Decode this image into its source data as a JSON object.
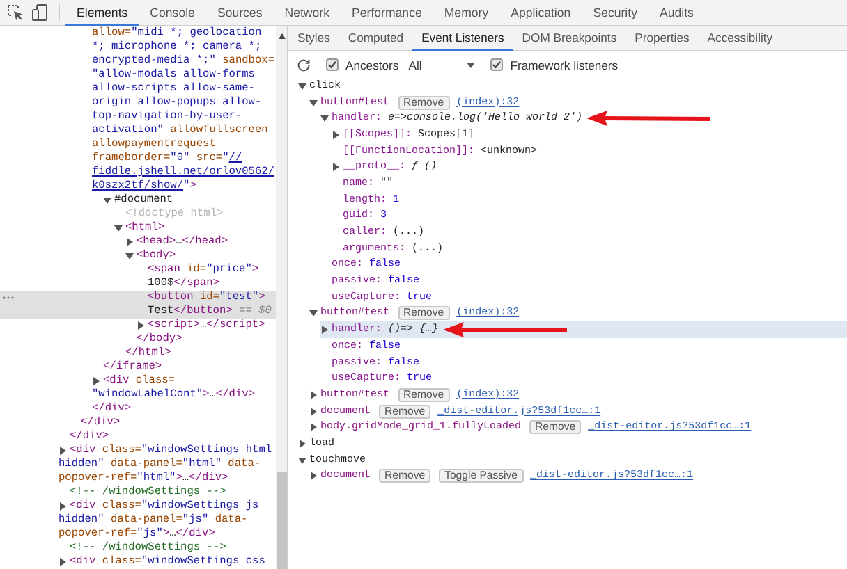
{
  "tabs": [
    {
      "label": "Elements",
      "selected": true
    },
    {
      "label": "Console",
      "selected": false
    },
    {
      "label": "Sources",
      "selected": false
    },
    {
      "label": "Network",
      "selected": false
    },
    {
      "label": "Performance",
      "selected": false
    },
    {
      "label": "Memory",
      "selected": false
    },
    {
      "label": "Application",
      "selected": false
    },
    {
      "label": "Security",
      "selected": false
    },
    {
      "label": "Audits",
      "selected": false
    }
  ],
  "dom": [
    {
      "children": [
        {
          "children": [
            {
              "children": [
                {
                  "selected": false,
                  "clipped_top": true,
                  "lines": [
                    [
                      {
                        "kind": "attr",
                        "text": "allow="
                      },
                      {
                        "kind": "value",
                        "text": "\"midi *; geolocation"
                      }
                    ],
                    [
                      {
                        "kind": "value",
                        "text": "*; microphone *; camera *;"
                      }
                    ],
                    [
                      {
                        "kind": "value",
                        "text": "encrypted-media *;\""
                      },
                      {
                        "kind": "attr",
                        "text": " sandbox="
                      }
                    ],
                    [
                      {
                        "kind": "value",
                        "text": "\"allow-modals allow-forms"
                      }
                    ],
                    [
                      {
                        "kind": "value",
                        "text": "allow-scripts allow-same-"
                      }
                    ],
                    [
                      {
                        "kind": "value",
                        "text": "origin allow-popups allow-"
                      }
                    ],
                    [
                      {
                        "kind": "value",
                        "text": "top-navigation-by-user-"
                      }
                    ],
                    [
                      {
                        "kind": "value",
                        "text": "activation\""
                      },
                      {
                        "kind": "attr",
                        "text": " allowfullscreen"
                      }
                    ],
                    [
                      {
                        "kind": "attr",
                        "text": "allowpaymentrequest"
                      }
                    ],
                    [
                      {
                        "kind": "attr",
                        "text": "frameborder="
                      },
                      {
                        "kind": "value",
                        "text": "\"0\""
                      },
                      {
                        "kind": "attr",
                        "text": " src="
                      },
                      {
                        "kind": "value",
                        "text": "\""
                      },
                      {
                        "kind": "link",
                        "text": "//"
                      }
                    ],
                    [
                      {
                        "kind": "link",
                        "text": "fiddle.jshell.net/orlov0562/"
                      }
                    ],
                    [
                      {
                        "kind": "link",
                        "text": "k0szx2tf/show/"
                      },
                      {
                        "kind": "value",
                        "text": "\""
                      },
                      {
                        "kind": "tag",
                        "text": ">"
                      }
                    ]
                  ],
                  "children": [
                    {
                      "selected": false,
                      "expanded": true,
                      "lines": [
                        [
                          {
                            "kind": "text",
                            "text": "#document"
                          }
                        ]
                      ],
                      "children": [
                        {
                          "selected": false,
                          "lines": [
                            [
                              {
                                "kind": "doctype",
                                "text": "<!doctype html>"
                              }
                            ]
                          ]
                        },
                        {
                          "selected": false,
                          "expanded": true,
                          "lines": [
                            [
                              {
                                "kind": "tag",
                                "text": "<html>"
                              }
                            ]
                          ],
                          "children": [
                            {
                              "selected": false,
                              "expanded": false,
                              "lines": [
                                [
                                  {
                                    "kind": "tag",
                                    "text": "<head>"
                                  },
                                  {
                                    "kind": "text",
                                    "text": "…"
                                  },
                                  {
                                    "kind": "tag",
                                    "text": "</head>"
                                  }
                                ]
                              ]
                            },
                            {
                              "selected": false,
                              "expanded": true,
                              "lines": [
                                [
                                  {
                                    "kind": "tag",
                                    "text": "<body>"
                                  }
                                ]
                              ],
                              "children": [
                                {
                                  "selected": false,
                                  "lines": [
                                    [
                                      {
                                        "kind": "tag",
                                        "text": "<span "
                                      },
                                      {
                                        "kind": "attr",
                                        "text": "id="
                                      },
                                      {
                                        "kind": "value",
                                        "text": "\"price\""
                                      },
                                      {
                                        "kind": "tag",
                                        "text": ">"
                                      }
                                    ],
                                    [
                                      {
                                        "kind": "text",
                                        "text": "100$"
                                      },
                                      {
                                        "kind": "tag",
                                        "text": "</span>"
                                      }
                                    ]
                                  ]
                                },
                                {
                                  "selected": true,
                                  "lines": [
                                    [
                                      {
                                        "kind": "tag",
                                        "text": "<button "
                                      },
                                      {
                                        "kind": "attr",
                                        "text": "id="
                                      },
                                      {
                                        "kind": "value",
                                        "text": "\"test\""
                                      },
                                      {
                                        "kind": "tag",
                                        "text": ">"
                                      }
                                    ],
                                    [
                                      {
                                        "kind": "text",
                                        "text": "Test"
                                      },
                                      {
                                        "kind": "tag",
                                        "text": "</button>"
                                      },
                                      {
                                        "kind": "muted",
                                        "text": " == $0"
                                      }
                                    ]
                                  ]
                                },
                                {
                                  "selected": false,
                                  "expanded": false,
                                  "lines": [
                                    [
                                      {
                                        "kind": "tag",
                                        "text": "<script>"
                                      },
                                      {
                                        "kind": "text",
                                        "text": "…"
                                      },
                                      {
                                        "kind": "tag",
                                        "text": "</script>"
                                      }
                                    ]
                                  ]
                                }
                              ],
                              "close": [
                                {
                                  "kind": "tag",
                                  "text": "</body>"
                                }
                              ]
                            }
                          ],
                          "close": [
                            {
                              "kind": "tag",
                              "text": "</html>"
                            }
                          ]
                        }
                      ]
                    }
                  ],
                  "close": [
                    {
                      "kind": "tag",
                      "text": "</iframe>"
                    }
                  ]
                },
                {
                  "selected": false,
                  "expanded": false,
                  "lines": [
                    [
                      {
                        "kind": "tag",
                        "text": "<div "
                      },
                      {
                        "kind": "attr",
                        "text": "class="
                      }
                    ],
                    [
                      {
                        "kind": "value",
                        "text": "\"windowLabelCont\""
                      },
                      {
                        "kind": "tag",
                        "text": ">"
                      },
                      {
                        "kind": "text",
                        "text": "…"
                      },
                      {
                        "kind": "tag",
                        "text": "</div>"
                      }
                    ]
                  ]
                }
              ],
              "close": [
                {
                  "kind": "tag",
                  "text": "</div>"
                }
              ]
            }
          ],
          "close": [
            {
              "kind": "tag",
              "text": "</div>"
            }
          ]
        }
      ],
      "close": [
        {
          "kind": "tag",
          "text": "</div>"
        }
      ]
    },
    {
      "selected": false,
      "expanded": false,
      "lines": [
        [
          {
            "kind": "tag",
            "text": "<div "
          },
          {
            "kind": "attr",
            "text": "class="
          },
          {
            "kind": "value",
            "text": "\"windowSettings html"
          }
        ],
        [
          {
            "kind": "value",
            "text": "hidden\""
          },
          {
            "kind": "attr",
            "text": " data-panel="
          },
          {
            "kind": "value",
            "text": "\"html\""
          },
          {
            "kind": "attr",
            "text": " data-"
          }
        ],
        [
          {
            "kind": "attr",
            "text": "popover-ref="
          },
          {
            "kind": "value",
            "text": "\"html\""
          },
          {
            "kind": "tag",
            "text": ">"
          },
          {
            "kind": "text",
            "text": "…"
          },
          {
            "kind": "tag",
            "text": "</div>"
          }
        ]
      ]
    },
    {
      "selected": false,
      "lines": [
        [
          {
            "kind": "comment",
            "text": "<!-- /windowSettings -->"
          }
        ]
      ]
    },
    {
      "selected": false,
      "expanded": false,
      "lines": [
        [
          {
            "kind": "tag",
            "text": "<div "
          },
          {
            "kind": "attr",
            "text": "class="
          },
          {
            "kind": "value",
            "text": "\"windowSettings js"
          }
        ],
        [
          {
            "kind": "value",
            "text": "hidden\""
          },
          {
            "kind": "attr",
            "text": " data-panel="
          },
          {
            "kind": "value",
            "text": "\"js\""
          },
          {
            "kind": "attr",
            "text": " data-"
          }
        ],
        [
          {
            "kind": "attr",
            "text": "popover-ref="
          },
          {
            "kind": "value",
            "text": "\"js\""
          },
          {
            "kind": "tag",
            "text": ">"
          },
          {
            "kind": "text",
            "text": "…"
          },
          {
            "kind": "tag",
            "text": "</div>"
          }
        ]
      ]
    },
    {
      "selected": false,
      "lines": [
        [
          {
            "kind": "comment",
            "text": "<!-- /windowSettings -->"
          }
        ]
      ]
    },
    {
      "selected": false,
      "expanded": false,
      "lines": [
        [
          {
            "kind": "tag",
            "text": "<div "
          },
          {
            "kind": "attr",
            "text": "class="
          },
          {
            "kind": "value",
            "text": "\"windowSettings css"
          }
        ]
      ]
    }
  ],
  "sidebar_tabs": [
    {
      "label": "Styles",
      "selected": false
    },
    {
      "label": "Computed",
      "selected": false
    },
    {
      "label": "Event Listeners",
      "selected": true
    },
    {
      "label": "DOM Breakpoints",
      "selected": false
    },
    {
      "label": "Properties",
      "selected": false
    },
    {
      "label": "Accessibility",
      "selected": false
    }
  ],
  "toolbar": {
    "ancestors": {
      "label": "Ancestors",
      "checked": true
    },
    "filter": {
      "value": "All"
    },
    "framework": {
      "label": "Framework listeners",
      "checked": true
    }
  },
  "listeners": [
    {
      "kind": "event",
      "name": "click",
      "expanded": true,
      "selected": false,
      "children": [
        {
          "kind": "listener",
          "target": "button#test",
          "buttons": [
            "Remove"
          ],
          "link": "(index):32",
          "expanded": true,
          "selected": false,
          "children": [
            {
              "kind": "property",
              "name": "handler:",
              "value": {
                "kind": "function",
                "text": "e=>console.log('Hello world 2')"
              },
              "expanded": true,
              "selected": false,
              "annotated": true,
              "children": [
                {
                  "kind": "property",
                  "name": "[[Scopes]]:",
                  "value": {
                    "kind": "plain",
                    "text": "Scopes[1]"
                  },
                  "expanded": false,
                  "selected": false
                },
                {
                  "kind": "property",
                  "name": "[[FunctionLocation]]:",
                  "value": {
                    "kind": "plain",
                    "text": "<unknown>"
                  },
                  "selected": false
                },
                {
                  "kind": "property",
                  "name": "__proto__:",
                  "value": {
                    "kind": "function",
                    "text": "ƒ ()"
                  },
                  "expanded": false,
                  "selected": false
                },
                {
                  "kind": "property",
                  "name": "name:",
                  "value": {
                    "kind": "string",
                    "text": "\"\""
                  },
                  "selected": false
                },
                {
                  "kind": "property",
                  "name": "length:",
                  "value": {
                    "kind": "number",
                    "text": "1"
                  },
                  "selected": false
                },
                {
                  "kind": "property",
                  "name": "guid:",
                  "value": {
                    "kind": "number",
                    "text": "3"
                  },
                  "selected": false
                },
                {
                  "kind": "property",
                  "name": "caller:",
                  "value": {
                    "kind": "plain",
                    "text": "(...)"
                  },
                  "selected": false
                },
                {
                  "kind": "property",
                  "name": "arguments:",
                  "value": {
                    "kind": "plain",
                    "text": "(...)"
                  },
                  "selected": false
                }
              ]
            },
            {
              "kind": "property",
              "name": "once:",
              "value": {
                "kind": "number",
                "text": "false"
              },
              "selected": false
            },
            {
              "kind": "property",
              "name": "passive:",
              "value": {
                "kind": "number",
                "text": "false"
              },
              "selected": false
            },
            {
              "kind": "property",
              "name": "useCapture:",
              "value": {
                "kind": "number",
                "text": "true"
              },
              "selected": false
            }
          ]
        },
        {
          "kind": "listener",
          "target": "button#test",
          "buttons": [
            "Remove"
          ],
          "link": "(index):32",
          "expanded": true,
          "selected": false,
          "children": [
            {
              "kind": "property",
              "name": "handler:",
              "value": {
                "kind": "function",
                "text": "()=> {…}"
              },
              "expanded": false,
              "selected": true,
              "annotated": true
            },
            {
              "kind": "property",
              "name": "once:",
              "value": {
                "kind": "number",
                "text": "false"
              },
              "selected": false
            },
            {
              "kind": "property",
              "name": "passive:",
              "value": {
                "kind": "number",
                "text": "false"
              },
              "selected": false
            },
            {
              "kind": "property",
              "name": "useCapture:",
              "value": {
                "kind": "number",
                "text": "true"
              },
              "selected": false
            }
          ]
        },
        {
          "kind": "listener",
          "target": "button#test",
          "buttons": [
            "Remove"
          ],
          "link": "(index):32",
          "expanded": false,
          "selected": false
        },
        {
          "kind": "listener",
          "target": "document",
          "buttons": [
            "Remove"
          ],
          "link": "_dist-editor.js?53df1cc…:1",
          "expanded": false,
          "selected": false
        },
        {
          "kind": "listener",
          "target": "body.gridMode_grid_1.fullyLoaded",
          "buttons": [
            "Remove"
          ],
          "link": "_dist-editor.js?53df1cc…:1",
          "expanded": false,
          "selected": false
        }
      ]
    },
    {
      "kind": "event",
      "name": "load",
      "expanded": false,
      "selected": false
    },
    {
      "kind": "event",
      "name": "touchmove",
      "expanded": true,
      "selected": false,
      "children": [
        {
          "kind": "listener",
          "target": "document",
          "buttons": [
            "Remove",
            "Toggle Passive"
          ],
          "link": "_dist-editor.js?53df1cc…:1",
          "expanded": false,
          "selected": false
        }
      ]
    }
  ]
}
